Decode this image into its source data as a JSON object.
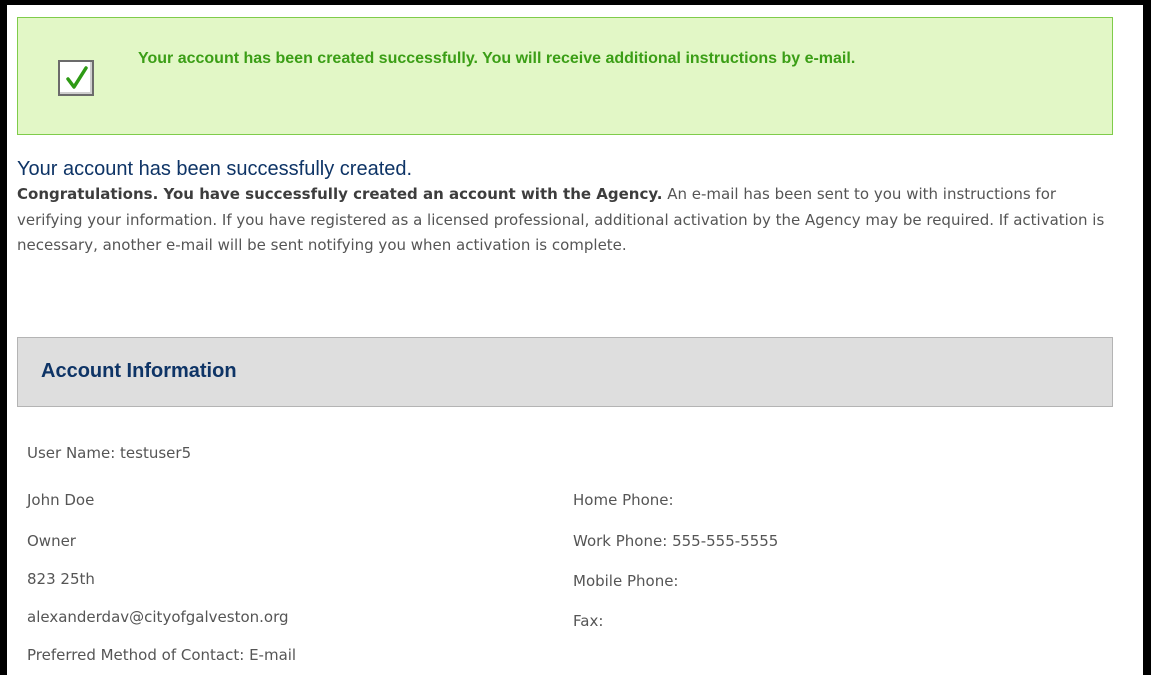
{
  "alert": {
    "message": "Your account has been created successfully. You will receive additional instructions by e-mail.",
    "icon": "checkmark-icon",
    "colors": {
      "background": "#e2f7c6",
      "border": "#7fcc4a",
      "text": "#3b9e16"
    }
  },
  "page": {
    "title": "Your account has been successfully created.",
    "intro_bold": "Congratulations. You have successfully created an account with the Agency.",
    "intro_text": " An e-mail has been sent to you with instructions for verifying your information. If you have registered as a licensed professional, additional activation by the Agency may be required. If activation is necessary, another e-mail will be sent notifying you when activation is complete."
  },
  "account": {
    "header": "Account Information",
    "username_label": "User Name:",
    "username": "testuser5",
    "name": "John Doe",
    "role": "Owner",
    "address": "823 25th",
    "email": "alexanderdav@cityofgalveston.org",
    "preferred_contact_label": "Preferred Method of Contact:",
    "preferred_contact": "E-mail",
    "phones": [
      {
        "label": "Home Phone:",
        "value": ""
      },
      {
        "label": "Work Phone:",
        "value": "555-555-5555"
      },
      {
        "label": "Mobile Phone:",
        "value": ""
      },
      {
        "label": "Fax:",
        "value": ""
      }
    ]
  }
}
